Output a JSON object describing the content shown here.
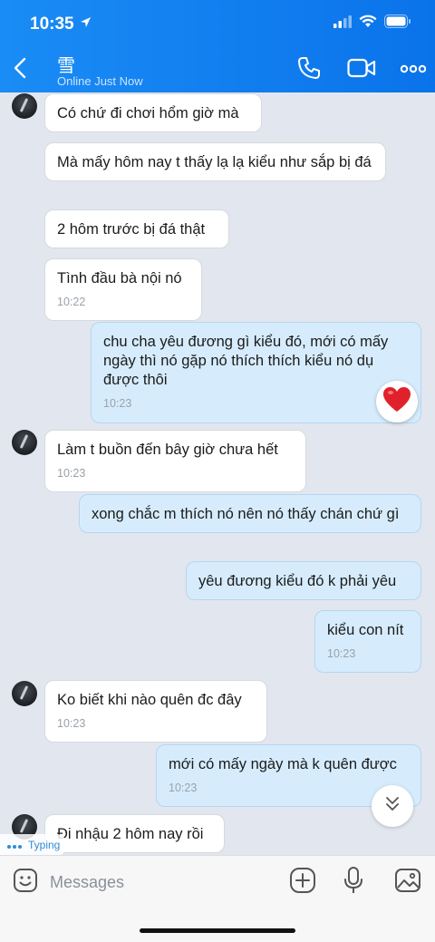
{
  "status_bar": {
    "time": "10:35"
  },
  "header": {
    "contact_name": "雪",
    "contact_status": "Online Just Now"
  },
  "messages": [
    {
      "dir": "in",
      "text": "Có chứ đi chơi hổm giờ mà",
      "time": ""
    },
    {
      "dir": "in",
      "text": "Mà mấy hôm nay t thấy lạ lạ kiểu như sắp bị đá",
      "time": ""
    },
    {
      "dir": "in",
      "text": "2 hôm trước bị đá thật",
      "time": ""
    },
    {
      "dir": "in",
      "text": "Tình đầu bà nội nó",
      "time": "10:22"
    },
    {
      "dir": "out",
      "text": "chu cha yêu đương gì kiểu đó, mới có mấy ngày thì nó gặp nó thích thích kiểu nó dụ được thôi",
      "time": "10:23",
      "reaction": "heart"
    },
    {
      "dir": "in",
      "text": "Làm t buồn đến bây giờ chưa hết",
      "time": "10:23"
    },
    {
      "dir": "out",
      "text": "xong chắc m thích nó nên nó thấy chán chứ gì",
      "time": ""
    },
    {
      "dir": "out",
      "text": "yêu đương kiểu đó k phải yêu",
      "time": ""
    },
    {
      "dir": "out",
      "text": "kiểu con nít",
      "time": "10:23"
    },
    {
      "dir": "in",
      "text": "Ko biết khi nào quên đc đây",
      "time": "10:23"
    },
    {
      "dir": "out",
      "text": "mới có mấy ngày mà k quên được",
      "time": "10:23"
    },
    {
      "dir": "in",
      "text": "Đi nhậu 2 hôm nay rồi",
      "time": ""
    }
  ],
  "typing_indicator": "Typing",
  "composer": {
    "placeholder": "Messages"
  },
  "colors": {
    "header": "#0a73ea",
    "incoming_bubble": "#ffffff",
    "outgoing_bubble": "#d6ecfd",
    "chat_bg": "#e2e6ee"
  },
  "icons": [
    "back-icon",
    "phone-icon",
    "video-icon",
    "more-icon",
    "heart-reaction-icon",
    "chevron-double-down-icon",
    "sticker-icon",
    "plus-icon",
    "microphone-icon",
    "image-icon"
  ]
}
